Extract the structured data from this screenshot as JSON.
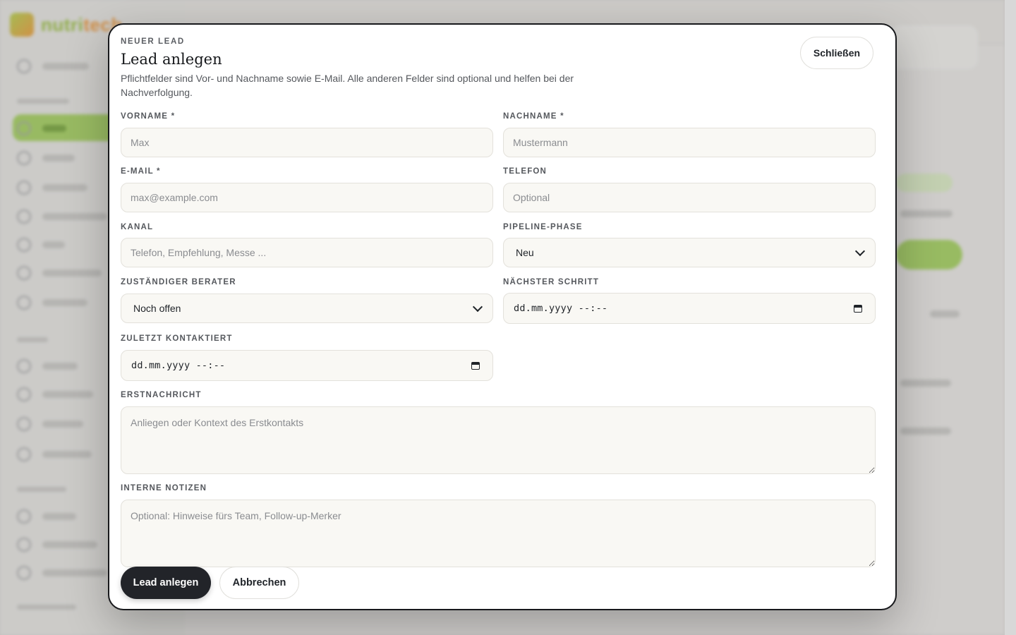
{
  "modal": {
    "eyebrow": "NEUER LEAD",
    "title": "Lead anlegen",
    "description": "Pflichtfelder sind Vor- und Nachname sowie E-Mail. Alle anderen Felder sind optional und helfen bei der Nachverfolgung.",
    "close_label": "Schließen"
  },
  "form": {
    "first_name": {
      "label": "VORNAME *",
      "placeholder": "Max",
      "value": ""
    },
    "last_name": {
      "label": "NACHNAME *",
      "placeholder": "Mustermann",
      "value": ""
    },
    "email": {
      "label": "E-MAIL *",
      "placeholder": "max@example.com",
      "value": ""
    },
    "phone": {
      "label": "TELEFON",
      "placeholder": "Optional",
      "value": ""
    },
    "channel": {
      "label": "KANAL",
      "placeholder": "Telefon, Empfehlung, Messe ...",
      "value": ""
    },
    "pipeline_phase": {
      "label": "PIPELINE-PHASE",
      "selected": "Neu"
    },
    "advisor": {
      "label": "ZUSTÄNDIGER BERATER",
      "selected": "Noch offen"
    },
    "next_step": {
      "label": "NÄCHSTER SCHRITT",
      "value": "dd.mm.yyyy --:--"
    },
    "last_contacted": {
      "label": "ZULETZT KONTAKTIERT",
      "value": "dd.mm.yyyy --:--"
    },
    "first_message": {
      "label": "ERSTNACHRICHT",
      "placeholder": "Anliegen oder Kontext des Erstkontakts"
    },
    "internal_notes": {
      "label": "INTERNE NOTIZEN",
      "placeholder": "Optional: Hinweise fürs Team, Follow-up-Merker"
    }
  },
  "actions": {
    "submit_label": "Lead anlegen",
    "cancel_label": "Abbrechen"
  },
  "icons": {
    "select_arrow": "chevron-down-icon",
    "date_picker": "calendar-icon"
  },
  "colors": {
    "primary_button": "#222429",
    "field_background": "#f9f8f4",
    "modal_border": "#17181b"
  }
}
